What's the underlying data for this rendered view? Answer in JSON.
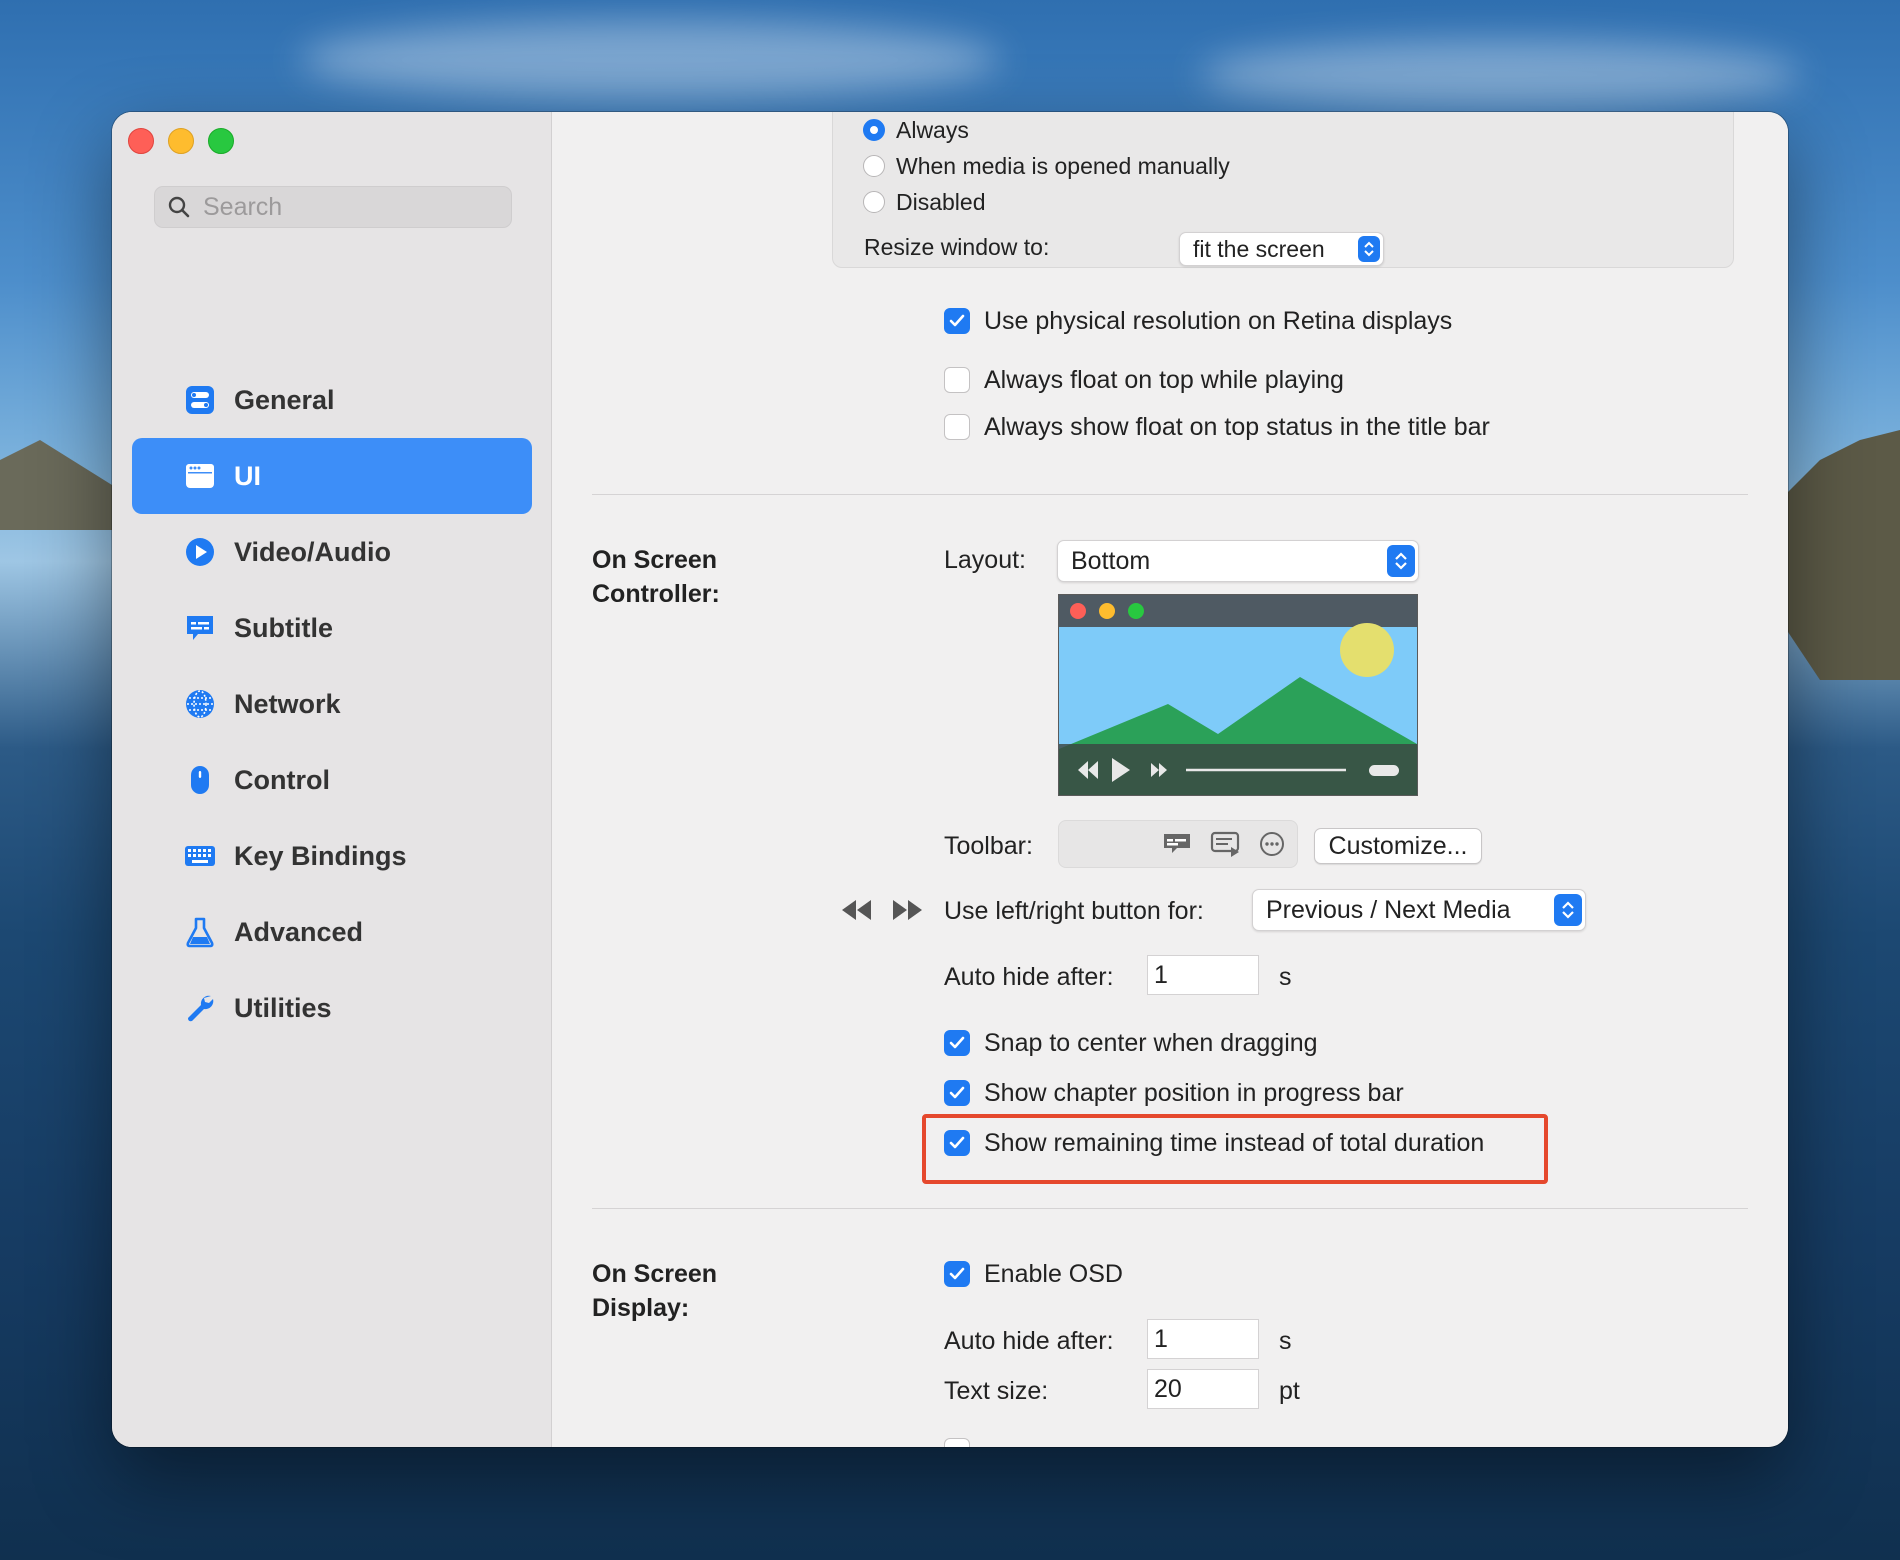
{
  "sidebar": {
    "search_placeholder": "Search",
    "items": [
      {
        "label": "General",
        "icon": "toggles-icon"
      },
      {
        "label": "UI",
        "icon": "window-icon"
      },
      {
        "label": "Video/Audio",
        "icon": "play-circle-icon"
      },
      {
        "label": "Subtitle",
        "icon": "subtitle-icon"
      },
      {
        "label": "Network",
        "icon": "globe-icon"
      },
      {
        "label": "Control",
        "icon": "mouse-icon"
      },
      {
        "label": "Key Bindings",
        "icon": "keyboard-icon"
      },
      {
        "label": "Advanced",
        "icon": "flask-icon"
      },
      {
        "label": "Utilities",
        "icon": "wrench-icon"
      }
    ],
    "active_item": "UI"
  },
  "window_behavior": {
    "options": [
      "Always",
      "When media is opened manually",
      "Disabled"
    ],
    "selected": "Always",
    "resize_label": "Resize window to:",
    "resize_value": "fit the screen"
  },
  "display_options": {
    "physical_resolution": "Use physical resolution on Retina displays",
    "float_on_top": "Always float on top while playing",
    "float_status": "Always show float on top status in the title bar"
  },
  "osc": {
    "title_line1": "On Screen",
    "title_line2": "Controller:",
    "layout_label": "Layout:",
    "layout_value": "Bottom",
    "toolbar_label": "Toolbar:",
    "customize_button": "Customize...",
    "leftright_label": "Use left/right button for:",
    "leftright_value": "Previous / Next Media",
    "autohide_label": "Auto hide after:",
    "autohide_value": "1",
    "autohide_unit": "s",
    "snap": "Snap to center when dragging",
    "chapter": "Show chapter position in progress bar",
    "remaining": "Show remaining time instead of total duration"
  },
  "osd": {
    "title_line1": "On Screen",
    "title_line2": "Display:",
    "enable": "Enable OSD",
    "autohide_label": "Auto hide after:",
    "autohide_value": "1",
    "autohide_unit": "s",
    "textsize_label": "Text size:",
    "textsize_value": "20",
    "textsize_unit": "pt"
  },
  "colors": {
    "accent": "#1f7af2",
    "sidebar_active": "#3d8ef8",
    "highlight_border": "#e5482d"
  }
}
